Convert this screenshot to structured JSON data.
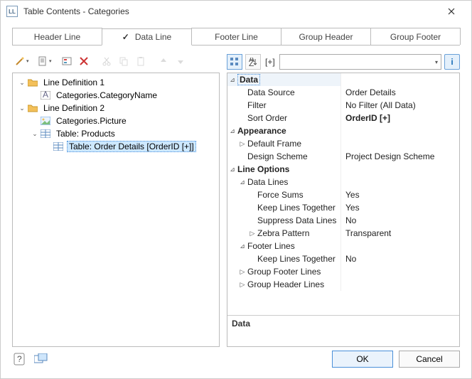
{
  "window": {
    "title": "Table Contents - Categories"
  },
  "tabs": {
    "header": "Header Line",
    "data": "Data Line",
    "footer": "Footer Line",
    "group_header": "Group Header",
    "group_footer": "Group Footer"
  },
  "tree": {
    "line_def_1": "Line Definition  1",
    "cat_name": "Categories.CategoryName",
    "line_def_2": "Line Definition  2",
    "cat_picture": "Categories.Picture",
    "table_products": "Table: Products",
    "table_order_details": "Table: Order Details [OrderID [+]]"
  },
  "prop_combo": {
    "bracket": "[+]"
  },
  "props": {
    "cat_data": "Data",
    "data_source": {
      "k": "Data Source",
      "v": "Order Details"
    },
    "filter": {
      "k": "Filter",
      "v": "No Filter (All Data)"
    },
    "sort_order": {
      "k": "Sort Order",
      "v": "OrderID [+]"
    },
    "cat_appearance": "Appearance",
    "default_frame": "Default Frame",
    "design_scheme": {
      "k": "Design Scheme",
      "v": "Project Design Scheme"
    },
    "cat_line_options": "Line Options",
    "data_lines": "Data Lines",
    "force_sums": {
      "k": "Force Sums",
      "v": "Yes"
    },
    "keep_lines": {
      "k": "Keep Lines Together",
      "v": "Yes"
    },
    "suppress": {
      "k": "Suppress Data Lines",
      "v": "No"
    },
    "zebra": {
      "k": "Zebra Pattern",
      "v": "Transparent"
    },
    "footer_lines": "Footer Lines",
    "footer_keep": {
      "k": "Keep Lines Together",
      "v": "No"
    },
    "group_footer_lines": "Group Footer Lines",
    "group_header_lines": "Group Header Lines"
  },
  "status": {
    "text": "Data"
  },
  "buttons": {
    "ok": "OK",
    "cancel": "Cancel"
  }
}
